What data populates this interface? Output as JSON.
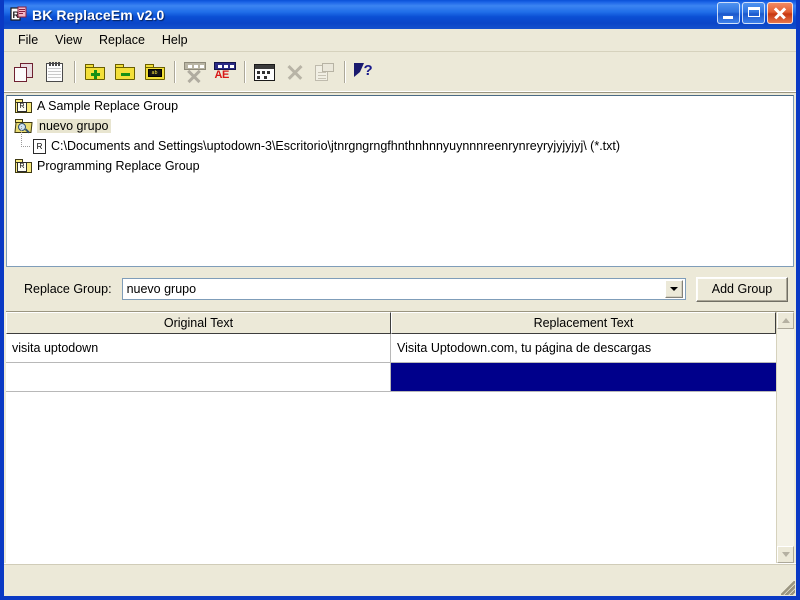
{
  "window": {
    "title": "BK ReplaceEm v2.0",
    "app_icon": "replace-document-icon",
    "titlebar_color": "#0a50d8",
    "buttons": {
      "minimize": "minimize-button",
      "maximize": "maximize-button",
      "close": "close-button"
    }
  },
  "menubar": {
    "items": [
      {
        "label": "File"
      },
      {
        "label": "View"
      },
      {
        "label": "Replace"
      },
      {
        "label": "Help"
      }
    ]
  },
  "toolbar": {
    "items": [
      {
        "name": "copy-documents-icon",
        "enabled": true
      },
      {
        "name": "new-notepad-icon",
        "enabled": true
      },
      {
        "name": "separator"
      },
      {
        "name": "add-group-folder-icon",
        "enabled": true
      },
      {
        "name": "remove-group-folder-icon",
        "enabled": true
      },
      {
        "name": "edit-group-folder-icon",
        "enabled": true
      },
      {
        "name": "separator"
      },
      {
        "name": "delete-replacement-icon",
        "enabled": false
      },
      {
        "name": "edit-replacement-ae-icon",
        "enabled": true
      },
      {
        "name": "separator"
      },
      {
        "name": "file-list-window-icon",
        "enabled": true
      },
      {
        "name": "remove-file-icon",
        "enabled": false
      },
      {
        "name": "file-properties-icon",
        "enabled": false
      },
      {
        "name": "separator"
      },
      {
        "name": "context-help-icon",
        "enabled": true
      }
    ]
  },
  "tree": {
    "nodes": [
      {
        "label": "A Sample Replace Group",
        "icon": "replace-group-folder-icon",
        "selected": false,
        "expanded": false,
        "level": 0
      },
      {
        "label": "nuevo grupo",
        "icon": "open-replace-group-folder-icon",
        "selected": true,
        "expanded": true,
        "level": 0
      },
      {
        "label": "C:\\Documents and Settings\\uptodown-3\\Escritorio\\jtnrgngrngfhnthnhnnyuynnnreenrynreyryjyjyjyj\\ (*.txt)",
        "icon": "replace-file-icon",
        "selected": false,
        "level": 1
      },
      {
        "label": "Programming Replace Group",
        "icon": "replace-group-folder-icon",
        "selected": false,
        "expanded": false,
        "level": 0
      }
    ]
  },
  "group_row": {
    "label": "Replace Group:",
    "combo_value": "nuevo grupo",
    "combo_placeholder": "",
    "dropdown_icon": "chevron-down-icon",
    "add_group_label": "Add Group"
  },
  "grid": {
    "columns": [
      {
        "key": "original",
        "label": "Original Text"
      },
      {
        "key": "replacement",
        "label": "Replacement Text"
      }
    ],
    "rows": [
      {
        "original": "visita uptodown",
        "replacement": "Visita Uptodown.com, tu página de descargas",
        "original_selected": false,
        "replacement_selected": false
      },
      {
        "original": "",
        "replacement": "",
        "original_selected": false,
        "replacement_selected": true
      }
    ],
    "selection_color": "#00008b",
    "scrollbar": {
      "up_icon": "scroll-up-arrow-icon",
      "down_icon": "scroll-down-arrow-icon"
    }
  },
  "statusbar": {
    "text": "",
    "grip_icon": "resize-grip-icon"
  }
}
